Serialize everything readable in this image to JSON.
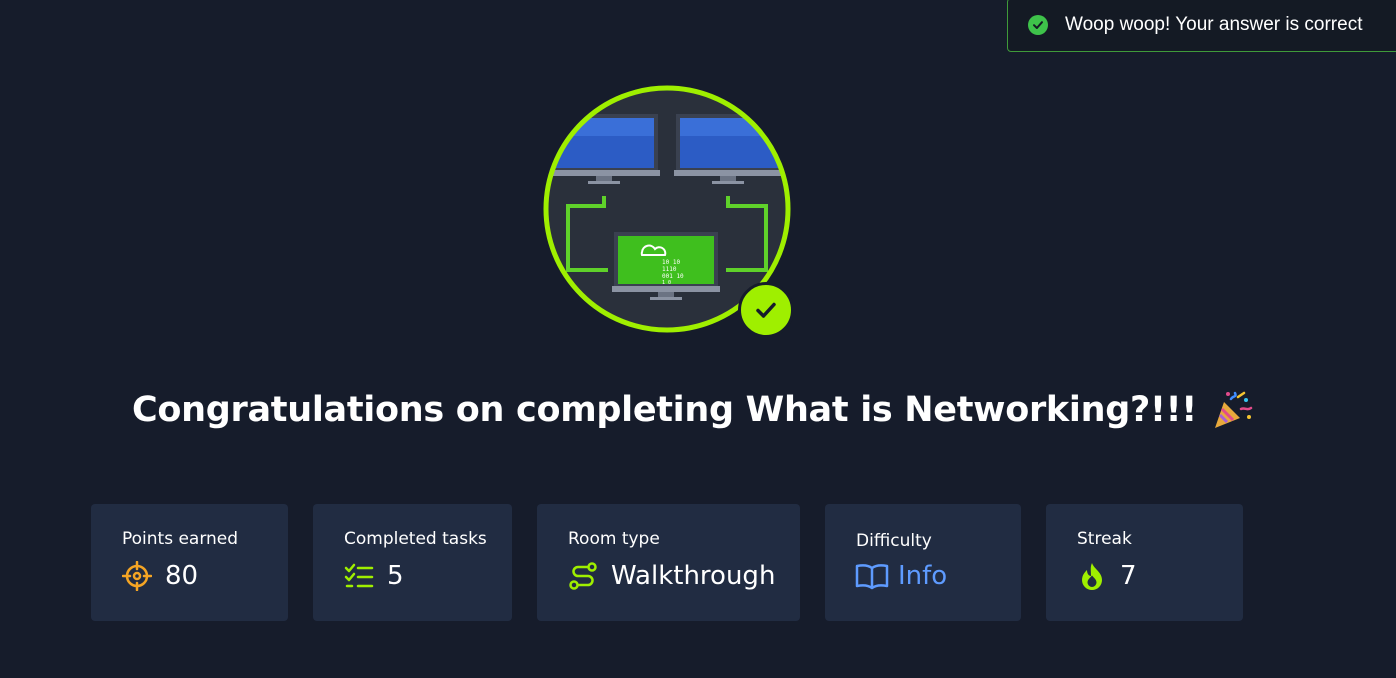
{
  "toast": {
    "message": "Woop woop! Your answer is correct",
    "icon": "check-circle-icon",
    "accent": "#3ec24a"
  },
  "badge": {
    "icon": "networking-badge-icon",
    "status_icon": "check-icon",
    "ring_color": "#9fef00",
    "digits": [
      "10 10",
      "1110",
      "001 10",
      "1 0"
    ]
  },
  "heading": {
    "text": "Congratulations on completing What is Networking?!!!",
    "emoji_icon": "party-popper-icon"
  },
  "stats": [
    {
      "label": "Points earned",
      "value": "80",
      "icon": "target-icon",
      "color": "#f5a524"
    },
    {
      "label": "Completed tasks",
      "value": "5",
      "icon": "task-list-icon",
      "color": "#9fef00"
    },
    {
      "label": "Room type",
      "value": "Walkthrough",
      "icon": "route-icon",
      "color": "#9fef00"
    },
    {
      "label": "Difficulty",
      "value": "Info",
      "icon": "book-icon",
      "color": "#5e9bff"
    },
    {
      "label": "Streak",
      "value": "7",
      "icon": "flame-icon",
      "color": "#9fef00"
    }
  ]
}
